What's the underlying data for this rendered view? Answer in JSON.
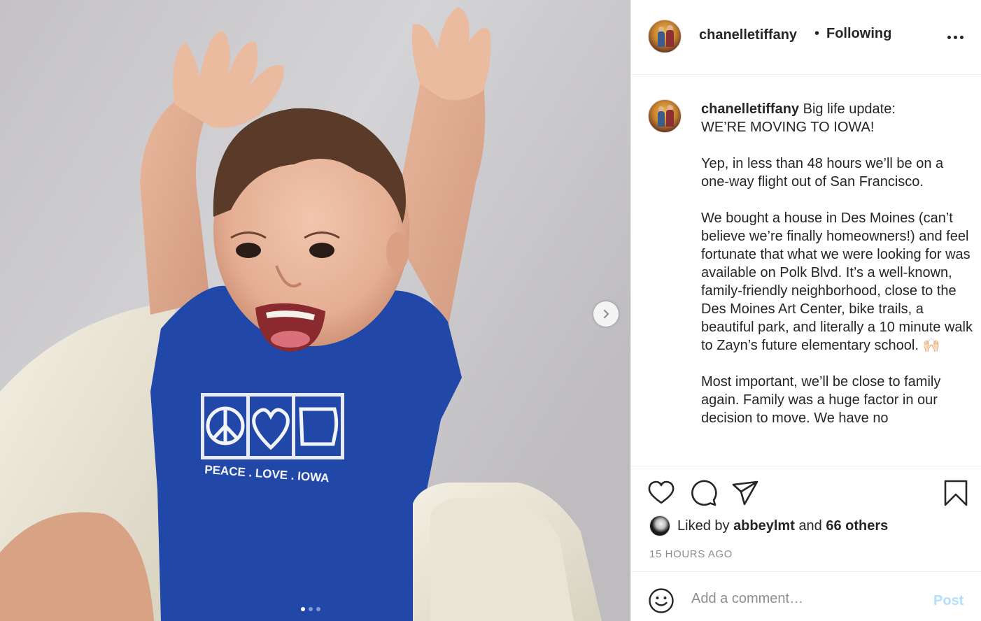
{
  "post": {
    "username": "chanelletiffany",
    "separator": "•",
    "follow_status": "Following",
    "caption_text": " Big life update:\nWE’RE MOVING TO IOWA!\n\nYep, in less than 48 hours we’ll be on a one-way flight out of San Francisco.\n\nWe bought a house in Des Moines (can’t believe we’re finally homeowners!) and feel fortunate that what we were looking for was available on Polk Blvd. It’s a well-known, family-friendly neighborhood, close to the Des Moines Art Center, bike trails, a beautiful park, and literally a 10 minute walk to Zayn’s future elementary school. 🙌🏻\n\nMost important, we’ll be close to family again. Family was a huge factor in our decision to move. We have no",
    "shirt_text": "PEACE . LOVE . IOWA"
  },
  "likes": {
    "prefix": "Liked by",
    "liker": "abbeylmt",
    "conjunction": "and",
    "others": "66 others"
  },
  "timestamp": "15 HOURS AGO",
  "comment": {
    "placeholder": "Add a comment…",
    "post_label": "Post"
  },
  "carousel": {
    "total": 3,
    "current": 1
  },
  "icons": {
    "like": "heart-icon",
    "comment": "comment-icon",
    "share": "paper-plane-icon",
    "save": "bookmark-icon",
    "emoji": "smiley-icon",
    "next": "chevron-right-icon",
    "more": "more-options-icon"
  },
  "colors": {
    "text": "#262626",
    "secondary": "#8e8e8e",
    "border": "#efefef",
    "post_disabled": "#b2dffc",
    "shirt_blue": "#2147a8"
  }
}
